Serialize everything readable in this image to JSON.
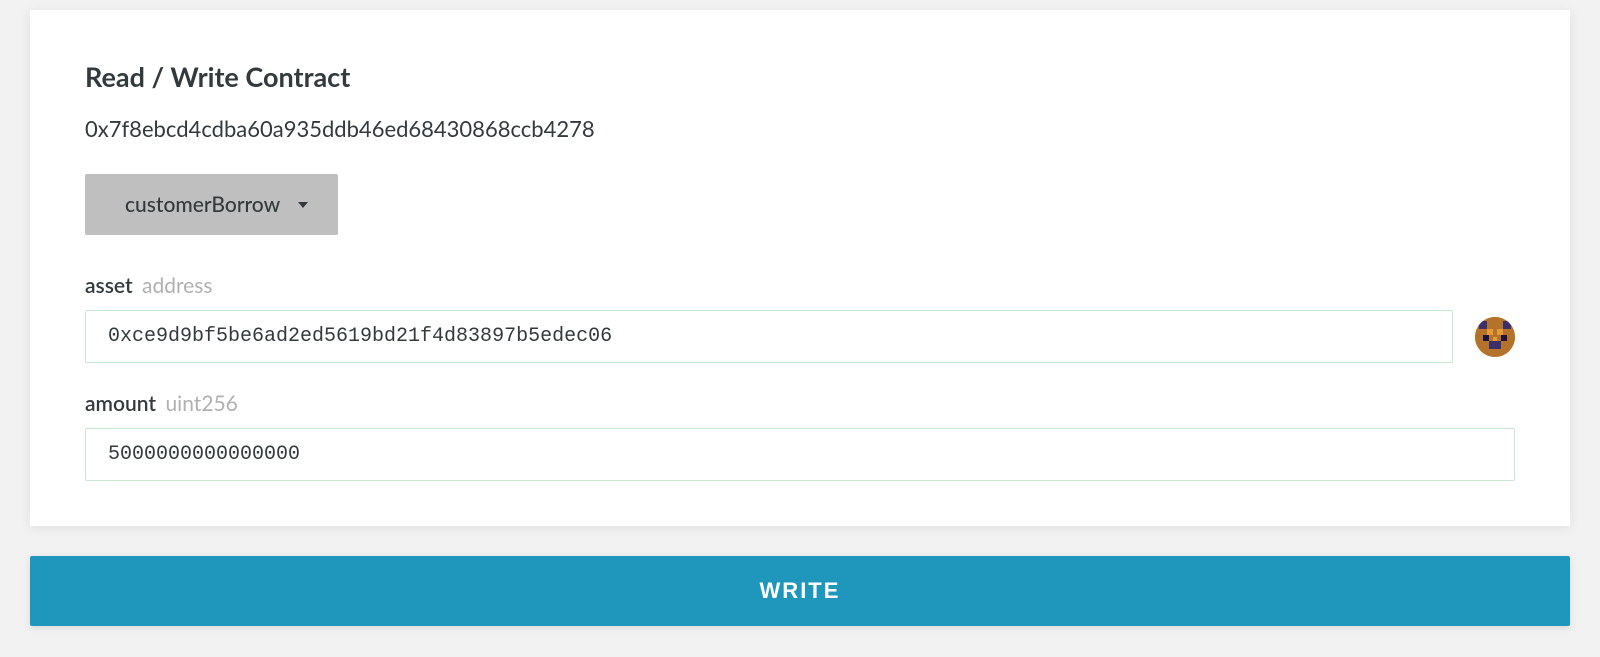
{
  "panel": {
    "heading": "Read / Write Contract",
    "contract_address": "0x7f8ebcd4cdba60a935ddb46ed68430868ccb4278"
  },
  "dropdown": {
    "selected": "customerBorrow"
  },
  "fields": {
    "asset": {
      "name": "asset",
      "type": "address",
      "value": "0xce9d9bf5be6ad2ed5619bd21f4d83897b5edec06"
    },
    "amount": {
      "name": "amount",
      "type": "uint256",
      "value": "5000000000000000"
    }
  },
  "actions": {
    "write_label": "WRITE"
  }
}
